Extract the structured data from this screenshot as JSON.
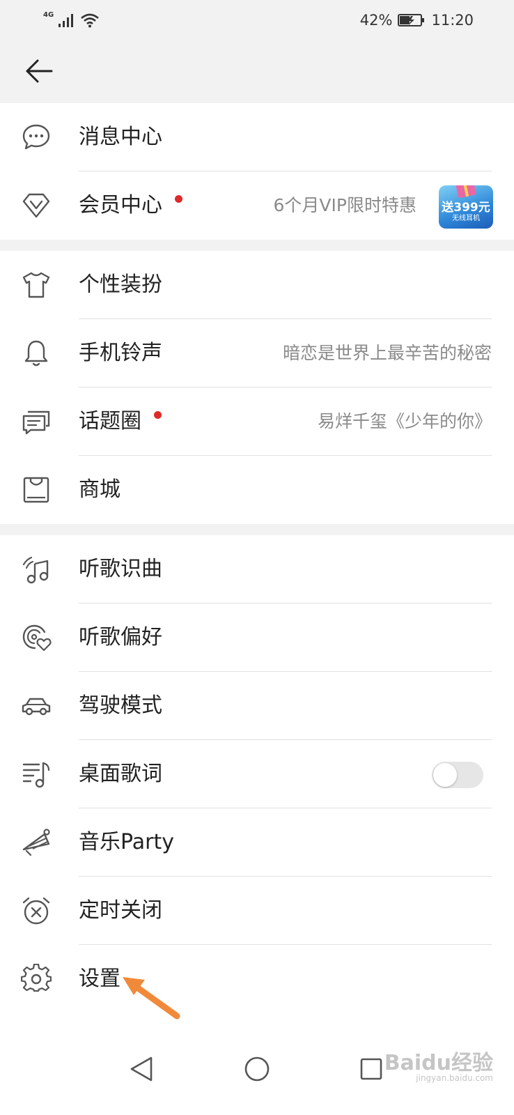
{
  "status_bar": {
    "network": "4G",
    "battery_percent": "42%",
    "time": "11:20"
  },
  "sections": [
    {
      "rows": [
        {
          "id": "messages",
          "icon": "chat-bubble-icon",
          "label": "消息中心",
          "dot": false,
          "value": ""
        },
        {
          "id": "vip",
          "icon": "diamond-v-icon",
          "label": "会员中心",
          "dot": true,
          "value": "6个月VIP限时特惠"
        }
      ]
    },
    {
      "rows": [
        {
          "id": "theme",
          "icon": "tshirt-icon",
          "label": "个性装扮",
          "dot": false,
          "value": ""
        },
        {
          "id": "ringtone",
          "icon": "bell-icon",
          "label": "手机铃声",
          "dot": false,
          "value": "暗恋是世界上最辛苦的秘密"
        },
        {
          "id": "topics",
          "icon": "topic-chat-icon",
          "label": "话题圈",
          "dot": true,
          "value": "易烊千玺《少年的你》"
        },
        {
          "id": "store",
          "icon": "shopping-bag-icon",
          "label": "商城",
          "dot": false,
          "value": ""
        }
      ]
    },
    {
      "rows": [
        {
          "id": "recognize",
          "icon": "music-note-wave-icon",
          "label": "听歌识曲",
          "dot": false,
          "value": ""
        },
        {
          "id": "preference",
          "icon": "music-heart-icon",
          "label": "听歌偏好",
          "dot": false,
          "value": ""
        },
        {
          "id": "drive",
          "icon": "car-icon",
          "label": "驾驶模式",
          "dot": false,
          "value": ""
        },
        {
          "id": "lyrics",
          "icon": "lyrics-icon",
          "label": "桌面歌词",
          "dot": false,
          "value": "",
          "toggle": "off"
        },
        {
          "id": "party",
          "icon": "party-hat-icon",
          "label": "音乐Party",
          "dot": false,
          "value": ""
        },
        {
          "id": "timer",
          "icon": "alarm-off-icon",
          "label": "定时关闭",
          "dot": false,
          "value": ""
        },
        {
          "id": "settings",
          "icon": "gear-icon",
          "label": "设置",
          "dot": false,
          "value": ""
        }
      ]
    }
  ],
  "vip_badge": {
    "line1": "送399元",
    "line2": "无线耳机"
  },
  "watermark": {
    "text": "Baidu经验",
    "site": "jingyan.baidu.com"
  },
  "colors": {
    "background_gray": "#f2f2f2",
    "red_dot": "#e02a2a",
    "arrow": "#f08a3a",
    "secondary_text": "#8a8a8a"
  }
}
